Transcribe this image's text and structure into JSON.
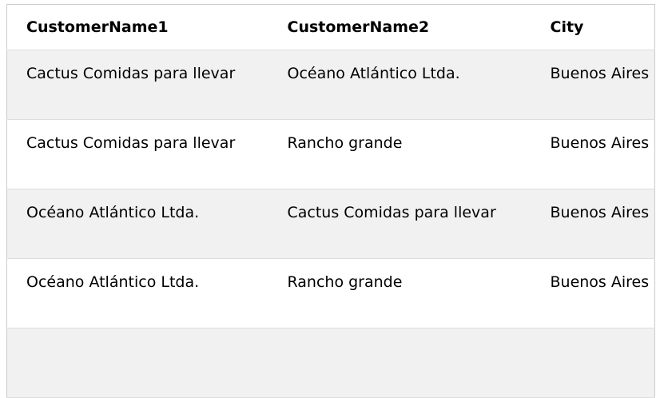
{
  "headers": [
    "CustomerName1",
    "CustomerName2",
    "City"
  ],
  "rows": [
    [
      "Cactus Comidas para llevar",
      "Océano Atlántico Ltda.",
      "Buenos Aires"
    ],
    [
      "Cactus Comidas para llevar",
      "Rancho grande",
      "Buenos Aires"
    ],
    [
      "Océano Atlántico Ltda.",
      "Cactus Comidas para llevar",
      "Buenos Aires"
    ],
    [
      "Océano Atlántico Ltda.",
      "Rancho grande",
      "Buenos Aires"
    ]
  ]
}
